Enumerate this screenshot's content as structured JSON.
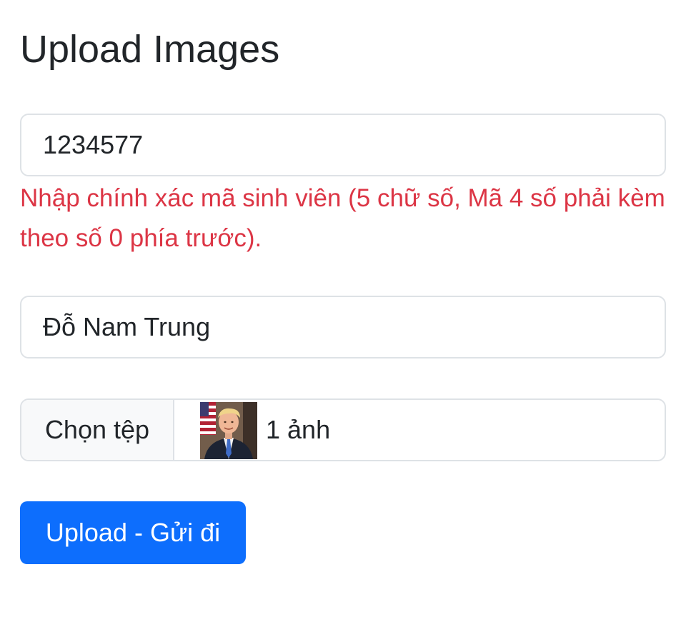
{
  "page": {
    "title": "Upload Images"
  },
  "student_id": {
    "value": "1234577",
    "error": "Nhập chính xác mã sinh viên (5 chữ số, Mã 4 số phải kèm theo số 0 phía trước)."
  },
  "full_name": {
    "value": "Đỗ Nam Trung"
  },
  "file_upload": {
    "button_label": "Chọn tệp",
    "selected_text": "1 ảnh",
    "thumbnail_icon": "portrait-thumbnail-icon"
  },
  "submit": {
    "label": "Upload - Gửi đi"
  },
  "colors": {
    "error": "#dc3545",
    "primary": "#0d6efd",
    "border": "#dee2e6",
    "text": "#212529"
  }
}
